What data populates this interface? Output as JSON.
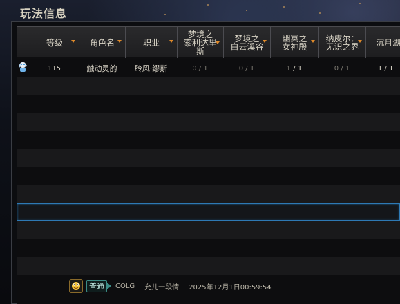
{
  "window": {
    "title": "玩法信息"
  },
  "table": {
    "columns": [
      {
        "label": "等级",
        "sortable": true
      },
      {
        "label": "角色名",
        "sortable": true
      },
      {
        "label": "职业",
        "sortable": true
      },
      {
        "label": "梦境之\n索利达里\n斯",
        "sortable": true
      },
      {
        "label": "梦境之\n白云溪谷",
        "sortable": true
      },
      {
        "label": "幽冥之\n女神殿",
        "sortable": true
      },
      {
        "label": "纳皮尔：\n无识之界",
        "sortable": true
      },
      {
        "label": "沉月湖",
        "sortable": false
      }
    ],
    "rows": [
      {
        "level": "115",
        "name": "触动灵韵",
        "job": "聆风·缪斯",
        "c1": "0 / 1",
        "c2": "0 / 1",
        "c3": "1 / 1",
        "c4": "0 / 1",
        "c5": "1 / 1"
      }
    ],
    "selected_row_index": 8
  },
  "chat": {
    "channel": "普通",
    "author": "COLG",
    "message": "允儿一段情",
    "timestamp": "2025年12月1日00:59:54"
  }
}
